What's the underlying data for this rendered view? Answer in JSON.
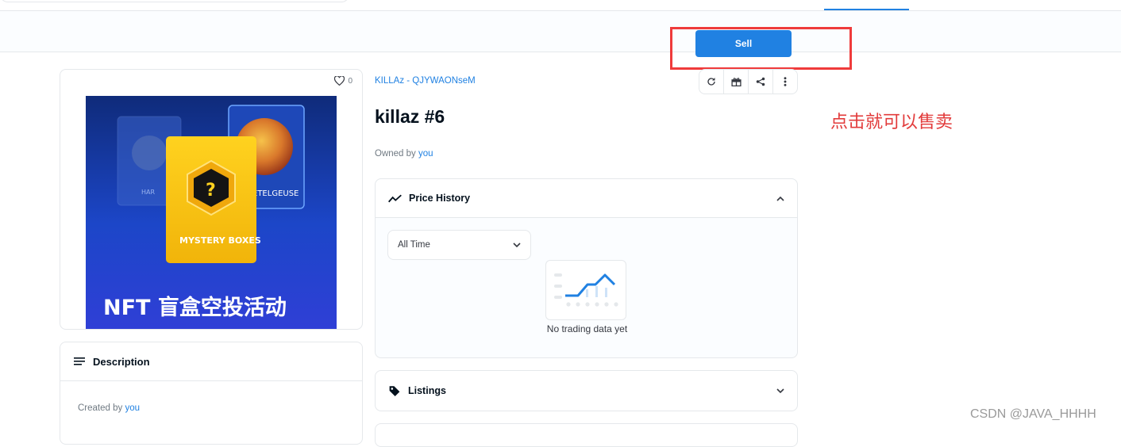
{
  "action_bar": {
    "sell_label": "Sell"
  },
  "asset": {
    "favorites": "0",
    "collection": "KILLAz - QJYWAONseM",
    "title": "killaz #6",
    "owned_prefix": "Owned by ",
    "owner": "you",
    "image_caption": "NFT 盲盒空投活动",
    "image_box_label": "MYSTERY BOXES",
    "image_card_label": "ETELGEUSE",
    "image_card_label_left": "HAR"
  },
  "description": {
    "title": "Description",
    "created_prefix": "Created by ",
    "creator": "you"
  },
  "price_history": {
    "title": "Price History",
    "range_selected": "All Time",
    "empty_text": "No trading data yet"
  },
  "listings": {
    "title": "Listings"
  },
  "annotation": {
    "text": "点击就可以售卖"
  },
  "watermark": {
    "text": "CSDN @JAVA_HHHH"
  },
  "colors": {
    "accent": "#2081e2",
    "annotation": "#e23b3b",
    "border": "#e5e8eb"
  },
  "icons": [
    "heart-icon",
    "refresh-icon",
    "gift-icon",
    "share-icon",
    "more-icon",
    "chart-line-icon",
    "chevron-up-icon",
    "chevron-down-icon",
    "tag-icon",
    "description-list-icon"
  ]
}
